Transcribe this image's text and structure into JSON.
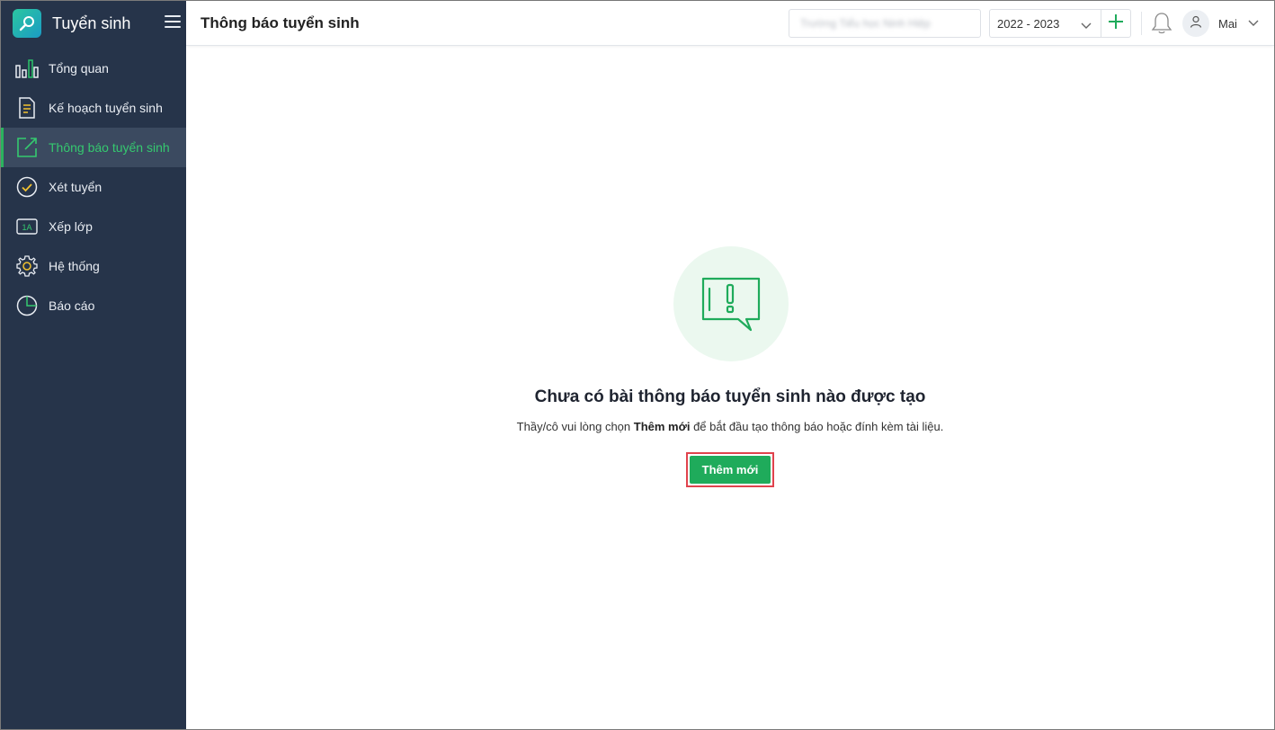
{
  "app": {
    "title": "Tuyển sinh"
  },
  "sidebar": {
    "items": [
      {
        "label": "Tổng quan",
        "icon": "bar-chart-icon"
      },
      {
        "label": "Kế hoạch tuyển sinh",
        "icon": "document-icon"
      },
      {
        "label": "Thông báo tuyển sinh",
        "icon": "edit-icon",
        "active": true
      },
      {
        "label": "Xét tuyển",
        "icon": "check-circle-icon"
      },
      {
        "label": "Xếp lớp",
        "icon": "class-1a-icon",
        "badge": "1A"
      },
      {
        "label": "Hệ thống",
        "icon": "gear-icon"
      },
      {
        "label": "Báo cáo",
        "icon": "pie-chart-icon"
      }
    ]
  },
  "header": {
    "page_title": "Thông báo tuyển sinh",
    "school_name_blurred": "Trường Tiểu học Ninh Hiệp",
    "year": "2022 - 2023",
    "user_name": "Mai"
  },
  "empty_state": {
    "title": "Chưa có bài thông báo tuyển sinh nào được tạo",
    "desc_before": "Thầy/cô vui lòng chọn ",
    "desc_bold": "Thêm mới",
    "desc_after": " để bắt đầu tạo thông báo hoặc đính kèm tài liệu.",
    "button_label": "Thêm mới"
  },
  "colors": {
    "sidebar_bg": "#26344a",
    "accent_green": "#1fab5b",
    "highlight_red": "#e0434d"
  }
}
